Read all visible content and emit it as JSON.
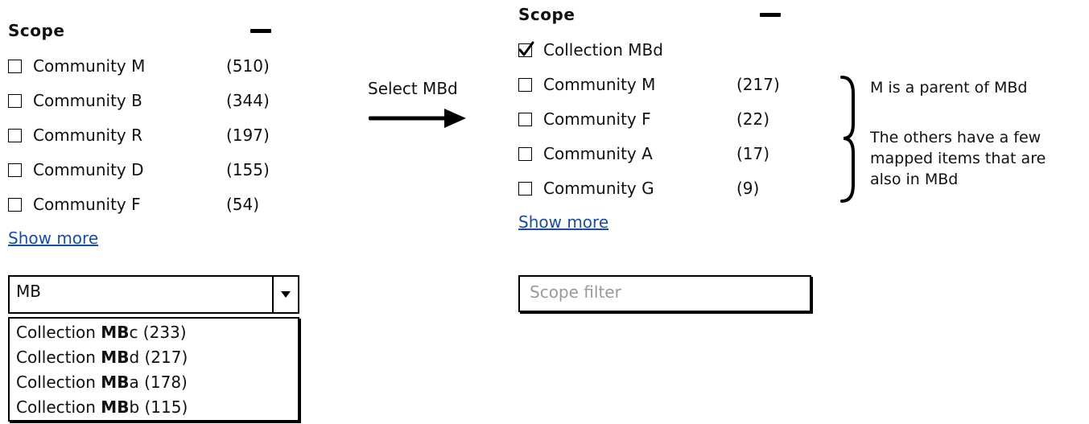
{
  "left": {
    "title": "Scope",
    "items": [
      {
        "label": "Community M",
        "count": "(510)"
      },
      {
        "label": "Community B",
        "count": "(344)"
      },
      {
        "label": "Community R",
        "count": "(197)"
      },
      {
        "label": "Community D",
        "count": "(155)"
      },
      {
        "label": "Community F",
        "count": "(54)"
      }
    ],
    "show_more": "Show more",
    "combo_value": "MB",
    "dropdown": [
      {
        "prefix": "Collection ",
        "bold": "MB",
        "suffix": "c (233)"
      },
      {
        "prefix": "Collection ",
        "bold": "MB",
        "suffix": "d (217)"
      },
      {
        "prefix": "Collection ",
        "bold": "MB",
        "suffix": "a (178)"
      },
      {
        "prefix": "Collection ",
        "bold": "MB",
        "suffix": "b (115)"
      }
    ]
  },
  "arrow_label": "Select MBd",
  "right": {
    "title": "Scope",
    "selected": {
      "label": "Collection MBd",
      "checked": true
    },
    "items": [
      {
        "label": "Community M",
        "count": "(217)"
      },
      {
        "label": "Community F",
        "count": "(22)"
      },
      {
        "label": "Community A",
        "count": "(17)"
      },
      {
        "label": "Community G",
        "count": "(9)"
      }
    ],
    "show_more": "Show more",
    "filter_placeholder": "Scope filter"
  },
  "notes": {
    "parent": "M is a parent of MBd",
    "others": [
      "The others have a few",
      "mapped items that are",
      "also in MBd"
    ]
  }
}
